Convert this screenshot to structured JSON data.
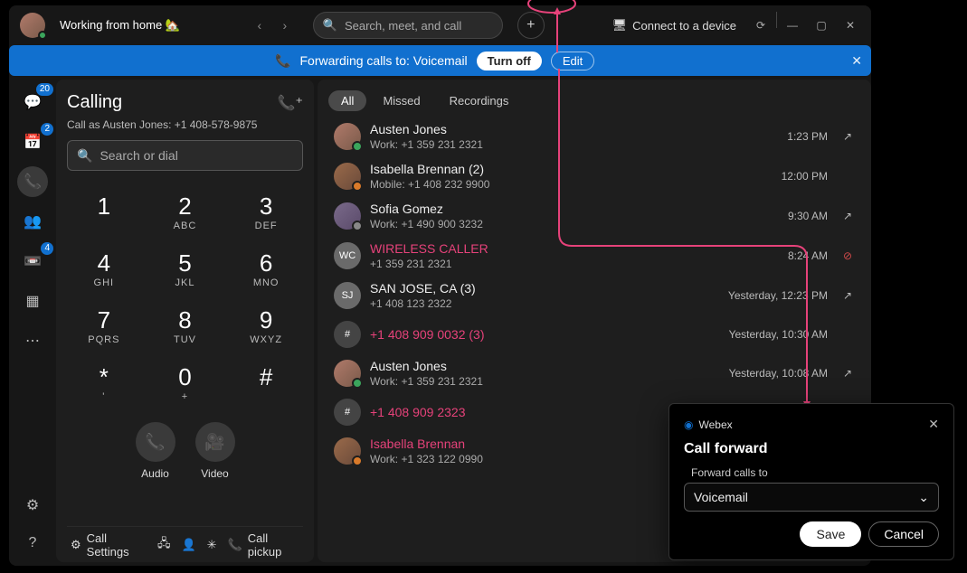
{
  "header": {
    "status": "Working from home 🏡",
    "search_placeholder": "Search, meet, and call",
    "connect_device": "Connect to a device"
  },
  "banner": {
    "text": "Forwarding calls to: Voicemail",
    "turn_off": "Turn off",
    "edit": "Edit"
  },
  "rail": {
    "badge_chat": "20",
    "badge_cal": "2",
    "badge_vm": "4"
  },
  "calling": {
    "title": "Calling",
    "subtitle": "Call as Austen Jones: +1 408-578-9875",
    "search_placeholder": "Search or dial",
    "keys": [
      {
        "num": "1",
        "sub": ""
      },
      {
        "num": "2",
        "sub": "ABC"
      },
      {
        "num": "3",
        "sub": "DEF"
      },
      {
        "num": "4",
        "sub": "GHI"
      },
      {
        "num": "5",
        "sub": "JKL"
      },
      {
        "num": "6",
        "sub": "MNO"
      },
      {
        "num": "7",
        "sub": "PQRS"
      },
      {
        "num": "8",
        "sub": "TUV"
      },
      {
        "num": "9",
        "sub": "WXYZ"
      },
      {
        "num": "*",
        "sub": "'"
      },
      {
        "num": "0",
        "sub": "+"
      },
      {
        "num": "#",
        "sub": ""
      }
    ],
    "audio": "Audio",
    "video": "Video"
  },
  "bottom": {
    "settings": "Call Settings",
    "pickup": "Call pickup"
  },
  "history": {
    "tabs": {
      "all": "All",
      "missed": "Missed",
      "recordings": "Recordings"
    },
    "rows": [
      {
        "avatar": "aj",
        "mini": "green",
        "name": "Austen Jones",
        "detail": "Work: +1 359 231 2321",
        "time": "1:23 PM",
        "icon": "out",
        "missed": false
      },
      {
        "avatar": "ib",
        "mini": "orange",
        "name": "Isabella Brennan (2)",
        "detail": "Mobile: +1 408 232 9900",
        "time": "12:00 PM",
        "icon": "",
        "missed": false
      },
      {
        "avatar": "sg",
        "mini": "clock",
        "name": "Sofia Gomez",
        "detail": "Work: +1 490 900 3232",
        "time": "9:30 AM",
        "icon": "out",
        "missed": false
      },
      {
        "avatar": "wc",
        "mini": "",
        "initials": "WC",
        "name": "WIRELESS CALLER",
        "detail": "+1 359 231 2321",
        "time": "8:24 AM",
        "icon": "block",
        "missed": true
      },
      {
        "avatar": "sj",
        "mini": "",
        "initials": "SJ",
        "name": "SAN JOSE, CA (3)",
        "detail": "+1 408 123 2322",
        "time": "Yesterday, 12:23 PM",
        "icon": "out",
        "missed": false
      },
      {
        "avatar": "hash",
        "mini": "",
        "initials": "#",
        "name": "+1 408 909 0032 (3)",
        "detail": "",
        "time": "Yesterday, 10:30 AM",
        "icon": "",
        "missed": true
      },
      {
        "avatar": "aj",
        "mini": "green",
        "name": "Austen Jones",
        "detail": "Work: +1 359 231 2321",
        "time": "Yesterday, 10:08 AM",
        "icon": "out",
        "missed": false
      },
      {
        "avatar": "hash",
        "mini": "",
        "initials": "#",
        "name": "+1 408 909 2323",
        "detail": "",
        "time": "",
        "icon": "",
        "missed": true
      },
      {
        "avatar": "ib",
        "mini": "orange",
        "name": "Isabella Brennan",
        "detail": "Work: +1 323 122 0990",
        "time": "",
        "icon": "",
        "missed": true
      }
    ]
  },
  "dialog": {
    "brand": "Webex",
    "title": "Call forward",
    "label": "Forward calls to",
    "value": "Voicemail",
    "save": "Save",
    "cancel": "Cancel"
  }
}
